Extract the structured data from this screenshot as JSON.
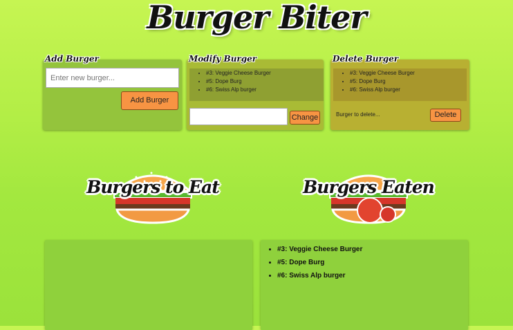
{
  "app": {
    "title": "Burger Biter"
  },
  "add_panel": {
    "title": "Add Burger",
    "input_placeholder": "Enter new burger...",
    "button_label": "Add Burger"
  },
  "modify_panel": {
    "title": "Modify Burger",
    "items": [
      "#3: Veggie Cheese Burger",
      "#5: Dope Burg",
      "#6: Swiss Alp burger"
    ],
    "input_value": "",
    "button_label": "Change"
  },
  "delete_panel": {
    "title": "Delete Burger",
    "items": [
      "#3: Veggie Cheese Burger",
      "#5: Dope Burg",
      "#6: Swiss Alp burger"
    ],
    "select_placeholder": "Burger to delete...",
    "button_label": "Delete"
  },
  "to_eat": {
    "label": "Burgers to Eat",
    "icon": "burger-icon",
    "items": []
  },
  "eaten": {
    "label": "Burgers Eaten",
    "icon": "bitten-burger-icon",
    "items": [
      "#3: Veggie Cheese Burger",
      "#5: Dope Burg",
      "#6: Swiss Alp burger"
    ]
  },
  "colors": {
    "background": "#b3ee46",
    "button": "#f79443",
    "add_panel": "#94c43c",
    "modify_panel": "#a9bb35",
    "delete_panel": "#b8b032"
  }
}
